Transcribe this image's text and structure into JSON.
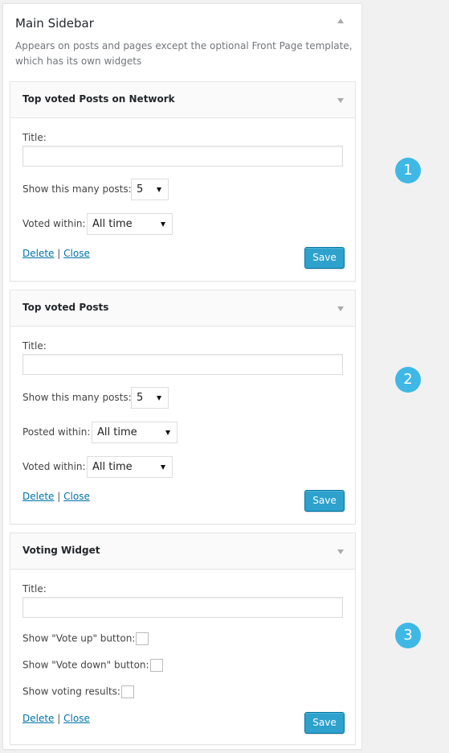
{
  "sidebar": {
    "title": "Main Sidebar",
    "description": "Appears on posts and pages except the optional Front Page template, which has its own widgets",
    "toggle_icon": "triangle-up"
  },
  "widgets": [
    {
      "title": "Top voted Posts on Network",
      "title_label": "Title:",
      "title_value": "",
      "posts_label": "Show this many posts:",
      "posts_value": "5",
      "voted_label": "Voted within:",
      "voted_value": "All time",
      "delete_label": "Delete",
      "separator": "|",
      "close_label": "Close",
      "save_label": "Save"
    },
    {
      "title": "Top voted Posts",
      "title_label": "Title:",
      "title_value": "",
      "posts_label": "Show this many posts:",
      "posts_value": "5",
      "posted_label": "Posted within:",
      "posted_value": "All time",
      "voted_label": "Voted within:",
      "voted_value": "All time",
      "delete_label": "Delete",
      "separator": "|",
      "close_label": "Close",
      "save_label": "Save"
    },
    {
      "title": "Voting Widget",
      "title_label": "Title:",
      "title_value": "",
      "vote_up_label": "Show \"Vote up\" button:",
      "vote_up_checked": false,
      "vote_down_label": "Show \"Vote down\" button:",
      "vote_down_checked": false,
      "results_label": "Show voting results:",
      "results_checked": false,
      "delete_label": "Delete",
      "separator": "|",
      "close_label": "Close",
      "save_label": "Save"
    }
  ],
  "badges": [
    "1",
    "2",
    "3"
  ],
  "colors": {
    "accent": "#2ea2cc",
    "badge": "#3fb8e6",
    "link": "#0073aa"
  }
}
